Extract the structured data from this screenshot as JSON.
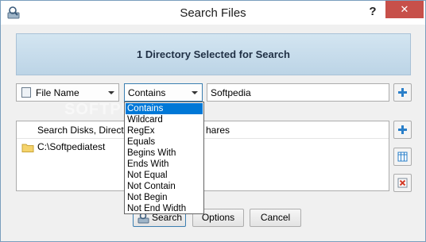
{
  "window": {
    "title": "Search Files",
    "help_label": "?",
    "close_label": "✕"
  },
  "banner": {
    "text": "1 Directory Selected for Search"
  },
  "field_select": {
    "value": "File Name"
  },
  "mode_select": {
    "value": "Contains",
    "options": [
      "Contains",
      "Wildcard",
      "RegEx",
      "Equals",
      "Begins With",
      "Ends With",
      "Not Equal",
      "Not Contain",
      "Not Begin",
      "Not End Width"
    ],
    "selected_index": 0
  },
  "search_input": {
    "value": "Softpedia"
  },
  "list": {
    "header_left": "Search Disks, Director",
    "header_right": "hares",
    "rows": [
      {
        "path": "C:\\Softpediatest"
      }
    ]
  },
  "buttons": {
    "search": "Search",
    "options": "Options",
    "cancel": "Cancel"
  },
  "watermark": "SOFTPEDIA",
  "colors": {
    "accent": "#0078d7",
    "close": "#c7504a",
    "banner": "#c8dcec"
  }
}
